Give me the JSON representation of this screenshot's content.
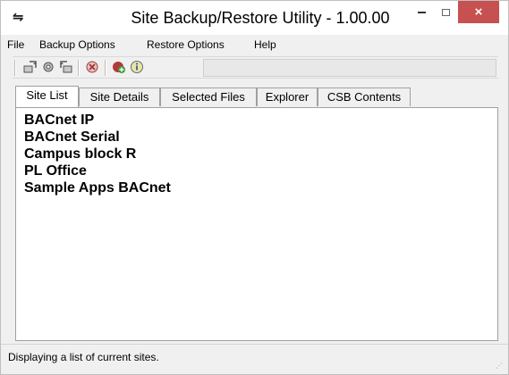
{
  "window": {
    "title": "Site Backup/Restore Utility - 1.00.00",
    "app_icon": "network-arrows-icon",
    "controls": {
      "minimize": "minimize-icon",
      "maximize": "maximize-icon",
      "close": "×"
    },
    "close_color": "#c75050"
  },
  "menu": {
    "items": [
      {
        "label": "File"
      },
      {
        "label": "Backup Options"
      },
      {
        "label": "Restore Options"
      },
      {
        "label": "Help"
      }
    ]
  },
  "toolbar": {
    "buttons": [
      {
        "icon": "backup-icon"
      },
      {
        "icon": "settings-gear-icon"
      },
      {
        "icon": "restore-icon"
      },
      {
        "icon": "stop-icon"
      },
      {
        "icon": "add-site-icon"
      },
      {
        "icon": "info-icon"
      }
    ]
  },
  "tabs": [
    {
      "label": "Site List",
      "active": true
    },
    {
      "label": "Site Details",
      "active": false
    },
    {
      "label": "Selected Files",
      "active": false
    },
    {
      "label": "Explorer",
      "active": false
    },
    {
      "label": "CSB Contents",
      "active": false
    }
  ],
  "site_list": {
    "items": [
      "BACnet IP",
      "BACnet Serial",
      "Campus block R",
      "PL Office",
      "Sample Apps BACnet"
    ]
  },
  "status": {
    "text": "Displaying a list of current sites."
  }
}
